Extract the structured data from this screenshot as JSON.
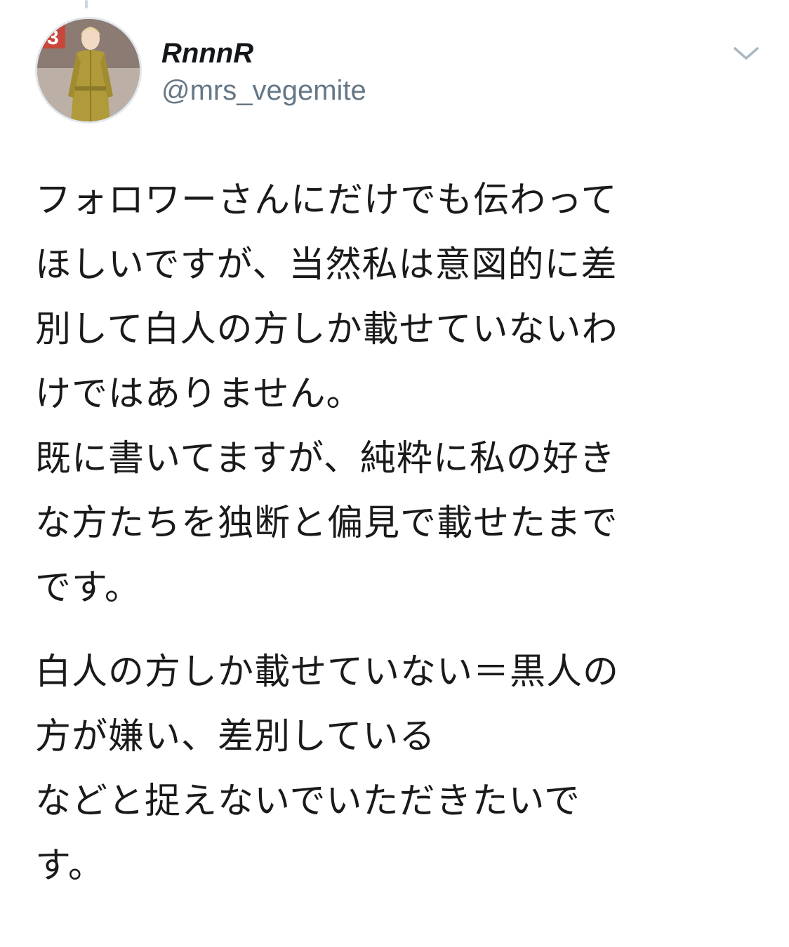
{
  "tweet": {
    "author": {
      "display_name": "RnnnR",
      "handle": "@mrs_vegemite",
      "avatar_icon": "profile-photo"
    },
    "menu_icon": "chevron-down-icon",
    "text_paragraphs": [
      {
        "lines": [
          "フォロワーさんにだけでも伝わって",
          "ほしいですが、当然私は意図的に差",
          "別して白人の方しか載せていないわ",
          "けではありません。",
          "既に書いてますが、純粋に私の好き",
          "な方たちを独断と偏見で載せたまで",
          "です。"
        ]
      },
      {
        "lines": [
          "白人の方しか載せていない＝黒人の",
          "方が嫌い、差別している",
          "などと捉えないでいただきたいで",
          "す。"
        ]
      }
    ]
  },
  "colors": {
    "text": "#1a1a1a",
    "secondary_text": "#657786",
    "chevron": "#aab8c2",
    "avatar_border": "#e1e8ed"
  }
}
